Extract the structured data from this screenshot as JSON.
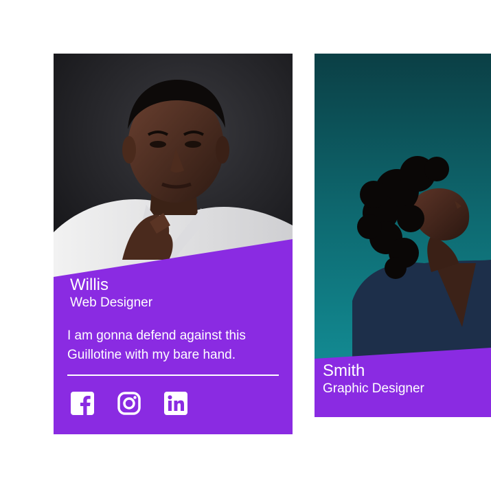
{
  "cards": [
    {
      "name": "Willis",
      "role": "Web Designer",
      "bio": "I am gonna defend against this Guillotine with my bare hand.",
      "photo_alt": "Portrait of a man in a white shirt with hand on chin",
      "social": [
        {
          "icon": "facebook-icon",
          "label": "Facebook"
        },
        {
          "icon": "instagram-icon",
          "label": "Instagram"
        },
        {
          "icon": "linkedin-icon",
          "label": "LinkedIn"
        }
      ]
    },
    {
      "name": "Smith",
      "role": "Graphic Designer",
      "photo_alt": "Portrait of a woman with curly hair looking upward"
    }
  ],
  "colors": {
    "accent": "#8a2be2",
    "text": "#ffffff",
    "page_background": "#ffffff"
  }
}
